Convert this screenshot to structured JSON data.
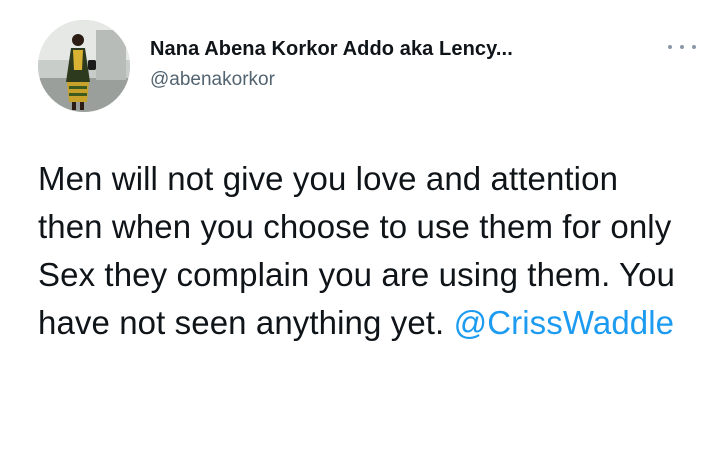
{
  "author": {
    "display_name": "Nana Abena Korkor Addo aka Lency...",
    "handle": "@abenakorkor",
    "avatar_icon": "profile-photo"
  },
  "menu": {
    "icon": "more-options-icon"
  },
  "tweet": {
    "text": "Men will not give you love and attention then when you choose to use them for only Sex they complain you are using them. You have not seen anything yet. ",
    "mention": "@CrissWaddle"
  },
  "colors": {
    "text": "#0f1419",
    "secondary": "#536471",
    "link": "#1d9bf0"
  }
}
